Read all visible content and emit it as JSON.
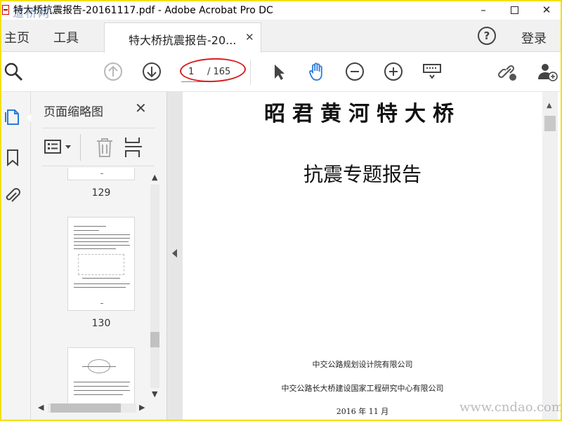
{
  "window": {
    "title": "特大桥抗震报告-20161117.pdf - Adobe Acrobat Pro DC",
    "minimize": "–",
    "close": "✕"
  },
  "watermarks": {
    "top": "道桥网",
    "bottom": "www.cndao.com"
  },
  "tabbar": {
    "home": "主页",
    "tools": "工具",
    "doc_tab": "特大桥抗震报告-20...",
    "doc_tab_close": "✕",
    "help": "?",
    "signin": "登录"
  },
  "toolbar": {
    "current_page": "1",
    "total_pages": "/ 165",
    "icons": [
      "search-icon",
      "prev-page-icon",
      "next-page-icon",
      "select-arrow-icon",
      "hand-icon",
      "zoom-out-icon",
      "zoom-in-icon",
      "keyboard-icon",
      "share-link-icon",
      "add-user-icon"
    ]
  },
  "thumbnail_panel": {
    "title": "页面缩略图",
    "close": "✕",
    "pages": [
      "129",
      "130"
    ]
  },
  "document": {
    "title": "昭君黄河特大桥",
    "subtitle": "抗震专题报告",
    "org1": "中交公路规划设计院有限公司",
    "org2": "中交公路长大桥建设国家工程研究中心有限公司",
    "date": "2016 年 11 月"
  },
  "colors": {
    "accent_blue": "#2b7bd8",
    "annotation_red": "#d81e1e",
    "frame_yellow": "#f2e000"
  }
}
